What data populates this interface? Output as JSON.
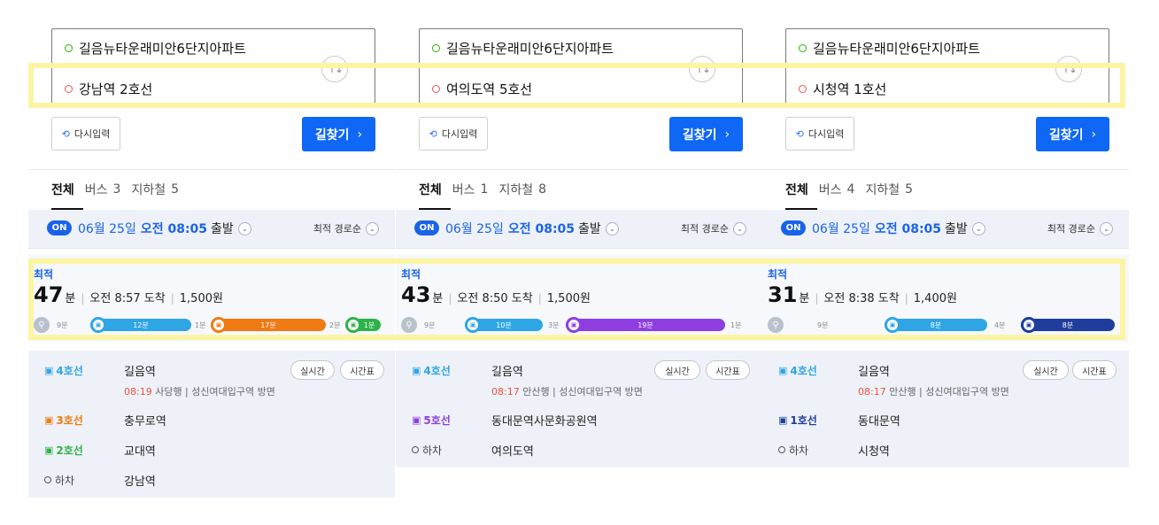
{
  "panels": [
    {
      "origin": "길음뉴타운래미안6단지아파트",
      "destination": "강남역 2호선",
      "reset_label": "다시입력",
      "find_label": "길찾기",
      "tabs": [
        {
          "label": "전체",
          "count": ""
        },
        {
          "label": "버스",
          "count": "3"
        },
        {
          "label": "지하철",
          "count": "5"
        }
      ],
      "on_badge": "ON",
      "departure": {
        "date": "06월 25일",
        "time": "오전 08:05",
        "suffix": "출발"
      },
      "sort_label": "최적 경로순",
      "summary": {
        "best": "최적",
        "minutes": "47",
        "unit": "분",
        "arrival": "오전 8:57 도착",
        "fare": "1,500원",
        "timeline": {
          "walk": "9분",
          "seg1": "12분",
          "gap1": "1분",
          "seg2": "17분",
          "gap2": "2분",
          "seg3": "1분"
        }
      },
      "steps": [
        {
          "line": "4호선",
          "station": "길음역",
          "time": "08:19",
          "info": "사당행 | 성신여대입구역 방면",
          "realtime": "실시간",
          "timetable": "시간표"
        },
        {
          "line": "3호선",
          "station": "충무로역"
        },
        {
          "line": "2호선",
          "station": "교대역"
        },
        {
          "line": "하차",
          "station": "강남역"
        }
      ]
    },
    {
      "origin": "길음뉴타운래미안6단지아파트",
      "destination": "여의도역 5호선",
      "reset_label": "다시입력",
      "find_label": "길찾기",
      "tabs": [
        {
          "label": "전체",
          "count": ""
        },
        {
          "label": "버스",
          "count": "1"
        },
        {
          "label": "지하철",
          "count": "8"
        }
      ],
      "on_badge": "ON",
      "departure": {
        "date": "06월 25일",
        "time": "오전 08:05",
        "suffix": "출발"
      },
      "sort_label": "최적 경로순",
      "summary": {
        "best": "최적",
        "minutes": "43",
        "unit": "분",
        "arrival": "오전 8:50 도착",
        "fare": "1,500원",
        "timeline": {
          "walk": "9분",
          "seg1": "10분",
          "gap1": "3분",
          "seg2": "19분",
          "gap2": "1분"
        }
      },
      "steps": [
        {
          "line": "4호선",
          "station": "길음역",
          "time": "08:17",
          "info": "안산행 | 성신여대입구역 방면",
          "realtime": "실시간",
          "timetable": "시간표"
        },
        {
          "line": "5호선",
          "station": "동대문역사문화공원역"
        },
        {
          "line": "하차",
          "station": "여의도역"
        }
      ]
    },
    {
      "origin": "길음뉴타운래미안6단지아파트",
      "destination": "시청역 1호선",
      "reset_label": "다시입력",
      "find_label": "길찾기",
      "tabs": [
        {
          "label": "전체",
          "count": ""
        },
        {
          "label": "버스",
          "count": "4"
        },
        {
          "label": "지하철",
          "count": "5"
        }
      ],
      "on_badge": "ON",
      "departure": {
        "date": "06월 25일",
        "time": "오전 08:05",
        "suffix": "출발"
      },
      "sort_label": "최적 경로순",
      "summary": {
        "best": "최적",
        "minutes": "31",
        "unit": "분",
        "arrival": "오전 8:38 도착",
        "fare": "1,400원",
        "timeline": {
          "walk": "9분",
          "seg1": "8분",
          "gap1": "4분",
          "seg2": "8분"
        }
      },
      "steps": [
        {
          "line": "4호선",
          "station": "길음역",
          "time": "08:17",
          "info": "안산행 | 성신여대입구역 방면",
          "realtime": "실시간",
          "timetable": "시간표"
        },
        {
          "line": "1호선",
          "station": "동대문역"
        },
        {
          "line": "하차",
          "station": "시청역"
        }
      ]
    }
  ],
  "colors": {
    "line4": "#2ea6e6",
    "line3": "#f07a14",
    "line2": "#2eb24a",
    "line5": "#8e3ee0",
    "line1": "#1f3d9c",
    "accent": "#0f67f5",
    "highlight": "#fbf5a3"
  }
}
